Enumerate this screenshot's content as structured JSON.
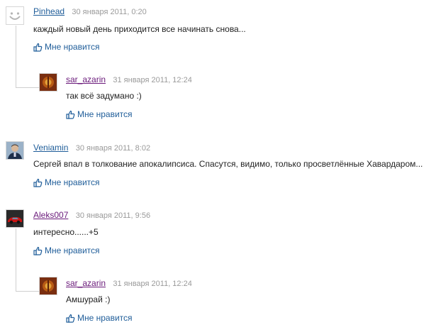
{
  "comments": [
    {
      "author": "Pinhead",
      "date": "30 января 2011, 0:20",
      "text": "каждый новый день приходится все начинать снова...",
      "like_label": "Мне нравится",
      "avatar": "smiley-placeholder-avatar"
    },
    {
      "author": "sar_azarin",
      "date": "31 января 2011, 12:24",
      "text": "так всё задумано :)",
      "like_label": "Мне нравится",
      "avatar": "emblem-avatar",
      "reply": true
    },
    {
      "author": "Veniamin",
      "date": "30 января 2011, 8:02",
      "text": "Сергей впал в толкование апокалипсиса. Спасутся, видимо, только просветлённые Хавардаром...",
      "like_label": "Мне нравится",
      "avatar": "man-photo-avatar"
    },
    {
      "author": "Aleks007",
      "date": "30 января 2011, 9:56",
      "text": "интересно......+5",
      "like_label": "Мне нравится",
      "avatar": "red-car-avatar"
    },
    {
      "author": "sar_azarin",
      "date": "31 января 2011, 12:24",
      "text": "Амшурай :)",
      "like_label": "Мне нравится",
      "avatar": "emblem-avatar",
      "reply": true
    }
  ],
  "colors": {
    "link": "#1f5d99",
    "visited_link": "#6a1a7a",
    "date": "#9a9a9a",
    "thread_line": "#cfcfcf"
  }
}
